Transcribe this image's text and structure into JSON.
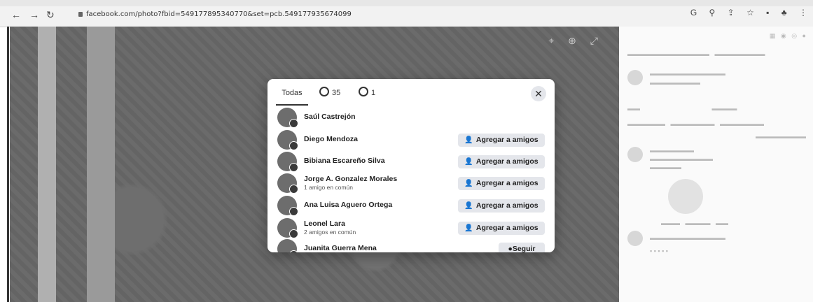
{
  "browser": {
    "url": "facebook.com/photo?fbid=549177895340770&set=pcb.549177935674099",
    "icons": [
      "back-icon",
      "forward-icon",
      "reload-icon",
      "lock-icon",
      "google-icon",
      "zoom-icon",
      "share-icon",
      "star-icon",
      "tab-icon",
      "extension-icon",
      "menu-icon"
    ]
  },
  "modal": {
    "tabs": [
      {
        "label": "Todas"
      },
      {
        "label": "35",
        "icon": "like-icon"
      },
      {
        "label": "1",
        "icon": "love-icon"
      }
    ],
    "close_glyph": "✕",
    "people": [
      {
        "name": "Saúl Castrejón",
        "mutual": "",
        "action": ""
      },
      {
        "name": "Diego Mendoza",
        "mutual": "",
        "action": "Agregar a amigos"
      },
      {
        "name": "Bibiana Escareño Silva",
        "mutual": "",
        "action": "Agregar a amigos"
      },
      {
        "name": "Jorge A. Gonzalez Morales",
        "mutual": "1 amigo en común",
        "action": "Agregar a amigos"
      },
      {
        "name": "Ana Luisa Aguero Ortega",
        "mutual": "",
        "action": "Agregar a amigos"
      },
      {
        "name": "Leonel Lara",
        "mutual": "2 amigos en común",
        "action": "Agregar a amigos"
      },
      {
        "name": "Juanita Guerra Mena",
        "mutual": "",
        "action": "Seguir"
      }
    ]
  }
}
